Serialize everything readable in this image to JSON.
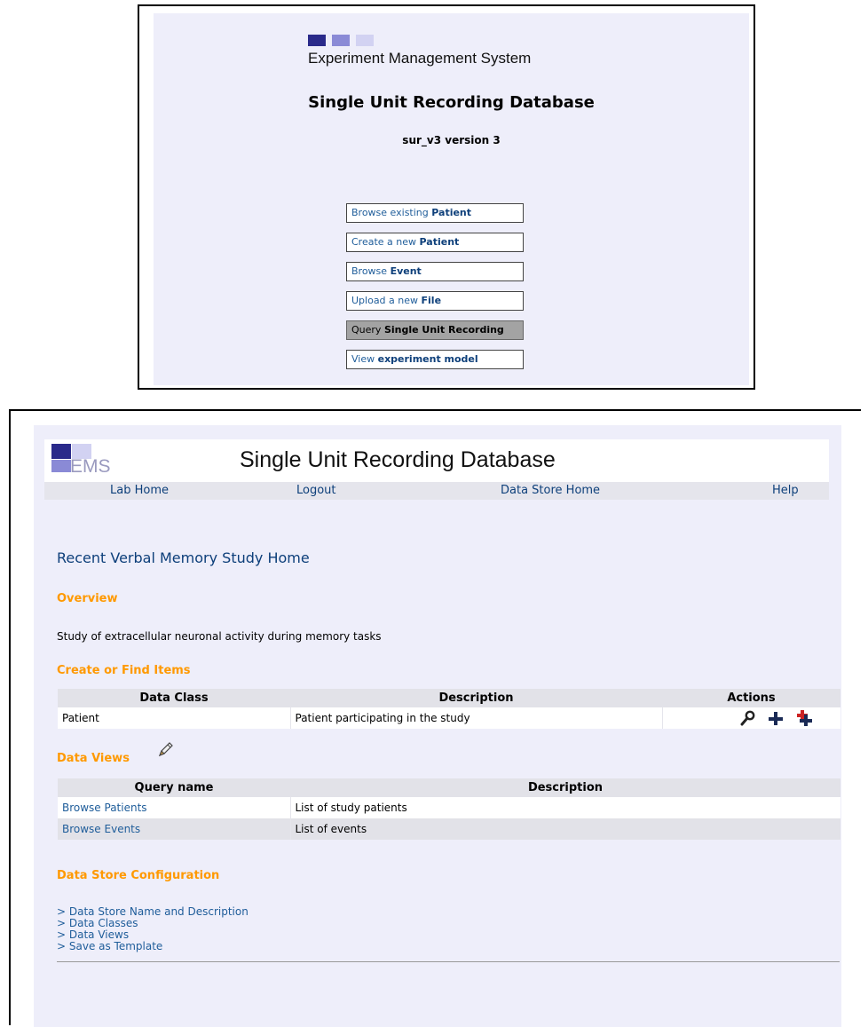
{
  "top_panel": {
    "logo_text": "Experiment Management System",
    "title": "Single Unit Recording Database",
    "subtitle": "sur_v3 version 3",
    "menu": [
      {
        "prefix": "Browse existing ",
        "bold": "Patient"
      },
      {
        "prefix": "Create a new ",
        "bold": "Patient"
      },
      {
        "prefix": "Browse ",
        "bold": "Event"
      },
      {
        "prefix": "Upload a new ",
        "bold": "File"
      },
      {
        "prefix": "Query ",
        "bold": "Single Unit Recording",
        "active": true
      },
      {
        "prefix": "View ",
        "bold": "experiment model"
      }
    ]
  },
  "header": {
    "logo_text": "EMS",
    "title": "Single Unit Recording Database"
  },
  "nav": {
    "lab_home": "Lab Home",
    "logout": "Logout",
    "data_store_home": "Data Store Home",
    "help": "Help"
  },
  "page": {
    "heading": "Recent Verbal Memory Study Home",
    "overview_title": "Overview",
    "overview_text": "Study of extracellular neuronal activity during memory tasks",
    "create_title": "Create or Find Items",
    "create_table": {
      "headers": [
        "Data Class",
        "Description",
        "Actions"
      ],
      "rows": [
        {
          "data_class": "Patient",
          "description": "Patient participating in the study",
          "actions": [
            "search-icon",
            "plus-icon",
            "multi-add-icon"
          ]
        }
      ]
    },
    "views_title": "Data Views",
    "views_table": {
      "headers": [
        "Query name",
        "Description"
      ],
      "rows": [
        {
          "name": "Browse Patients",
          "description": "List of study patients"
        },
        {
          "name": "Browse Events",
          "description": "List of events"
        }
      ]
    },
    "config_title": "Data Store Configuration",
    "config_links": [
      "> Data Store Name and Description",
      "> Data Classes",
      "> Data Views",
      "> Save as Template"
    ]
  },
  "colors": {
    "accent_orange": "#ff9900",
    "link_blue": "#1f5d9a",
    "heading_blue": "#0d3f7a",
    "panel_bg": "#eeeefa",
    "logo_dark": "#2a2a8a",
    "logo_mid": "#8a8ad6",
    "logo_light": "#d2d2f2",
    "add_red": "#cc2222"
  }
}
